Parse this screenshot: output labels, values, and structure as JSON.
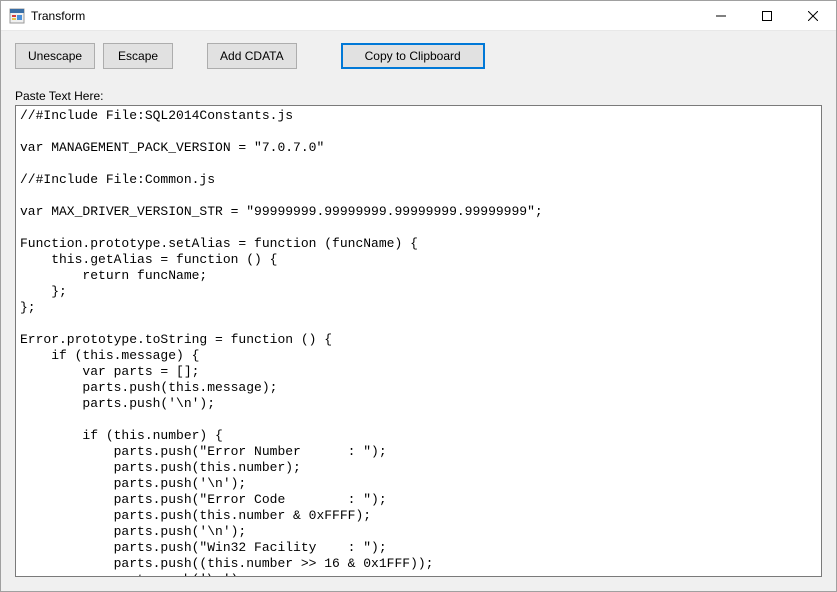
{
  "window": {
    "title": "Transform"
  },
  "toolbar": {
    "unescape_label": "Unescape",
    "escape_label": "Escape",
    "add_cdata_label": "Add CDATA",
    "copy_label": "Copy to Clipboard"
  },
  "editor": {
    "label": "Paste Text Here:",
    "content": "//#Include File:SQL2014Constants.js\n\nvar MANAGEMENT_PACK_VERSION = \"7.0.7.0\"\n\n//#Include File:Common.js\n\nvar MAX_DRIVER_VERSION_STR = \"99999999.99999999.99999999.99999999\";\n\nFunction.prototype.setAlias = function (funcName) {\n    this.getAlias = function () {\n        return funcName;\n    };\n};\n\nError.prototype.toString = function () {\n    if (this.message) {\n        var parts = [];\n        parts.push(this.message);\n        parts.push('\\n');\n\n        if (this.number) {\n            parts.push(\"Error Number      : \");\n            parts.push(this.number);\n            parts.push('\\n');\n            parts.push(\"Error Code        : \");\n            parts.push(this.number & 0xFFFF);\n            parts.push('\\n');\n            parts.push(\"Win32 Facility    : \");\n            parts.push((this.number >> 16 & 0x1FFF));\n            parts.push('\\n');\n"
  }
}
